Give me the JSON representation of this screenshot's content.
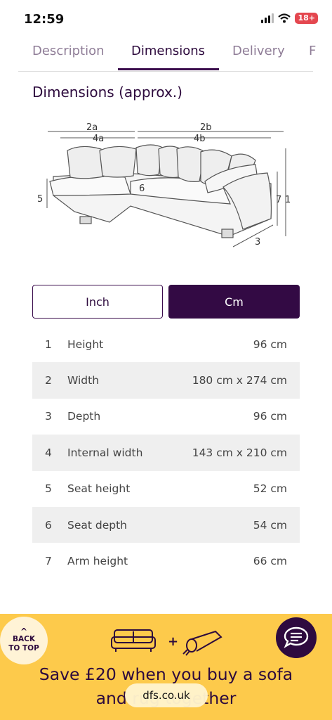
{
  "status": {
    "time": "12:59",
    "battery": "18+"
  },
  "tabs": [
    {
      "label": "Description"
    },
    {
      "label": "Dimensions"
    },
    {
      "label": "Delivery"
    },
    {
      "label": "F"
    }
  ],
  "section_title": "Dimensions (approx.)",
  "diagram": {
    "labels": [
      "2a",
      "4a",
      "2b",
      "4b",
      "5",
      "6",
      "7",
      "1",
      "3"
    ]
  },
  "units": {
    "inch": "Inch",
    "cm": "Cm",
    "selected": "Cm"
  },
  "dimensions": [
    {
      "num": "1",
      "label": "Height",
      "value": "96 cm"
    },
    {
      "num": "2",
      "label": "Width",
      "value": "180 cm x 274 cm"
    },
    {
      "num": "3",
      "label": "Depth",
      "value": "96 cm"
    },
    {
      "num": "4",
      "label": "Internal width",
      "value": "143 cm x 210 cm"
    },
    {
      "num": "5",
      "label": "Seat height",
      "value": "52 cm"
    },
    {
      "num": "6",
      "label": "Seat depth",
      "value": "54 cm"
    },
    {
      "num": "7",
      "label": "Arm height",
      "value": "66 cm"
    }
  ],
  "promo": {
    "back_to_top_line1": "BACK",
    "back_to_top_line2": "TO TOP",
    "plus": "+",
    "text_line1": "Save £20 when you buy a sofa",
    "text_line2": "and rug together",
    "url": "dfs.co.uk"
  },
  "colors": {
    "accent": "#330a44",
    "promo_bg": "#fdca4b",
    "row_alt": "#efefef"
  }
}
